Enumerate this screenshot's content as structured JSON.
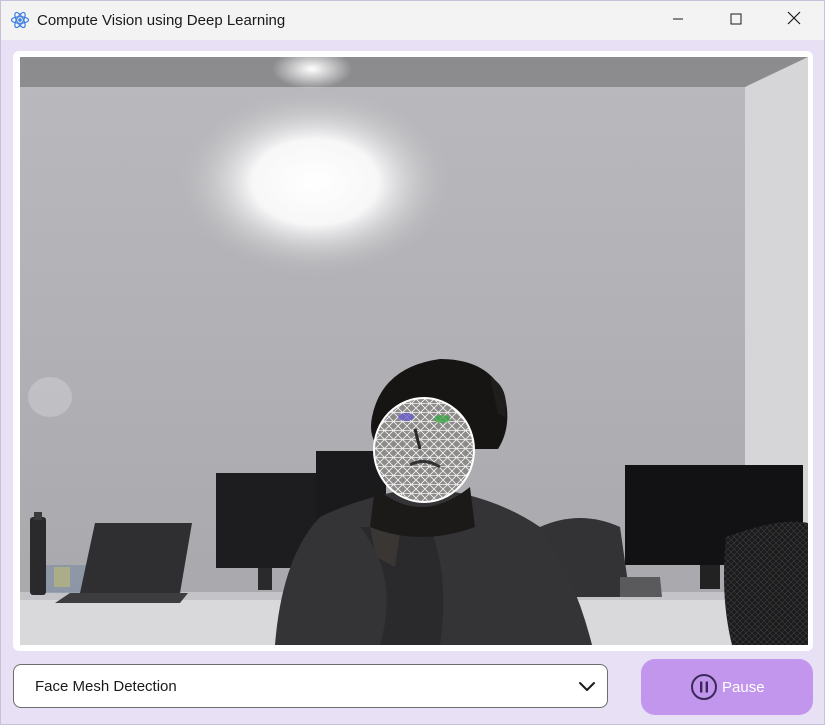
{
  "window": {
    "title": "Compute Vision using Deep Learning",
    "app_icon": "atom-icon",
    "controls": [
      "minimize-icon",
      "maximize-icon",
      "close-icon"
    ]
  },
  "video_feed": {
    "overlay": "face-mesh"
  },
  "controls": {
    "model_select": {
      "value": "Face Mesh Detection",
      "icon": "chevron-down-icon"
    },
    "pause_button": {
      "label": "Pause",
      "icon": "pause-icon"
    }
  },
  "colors": {
    "window_bg": "#e8e0f5",
    "titlebar_bg": "#f3f3f3",
    "accent": "#c296ec",
    "pause_icon": "#3a2a5a"
  }
}
